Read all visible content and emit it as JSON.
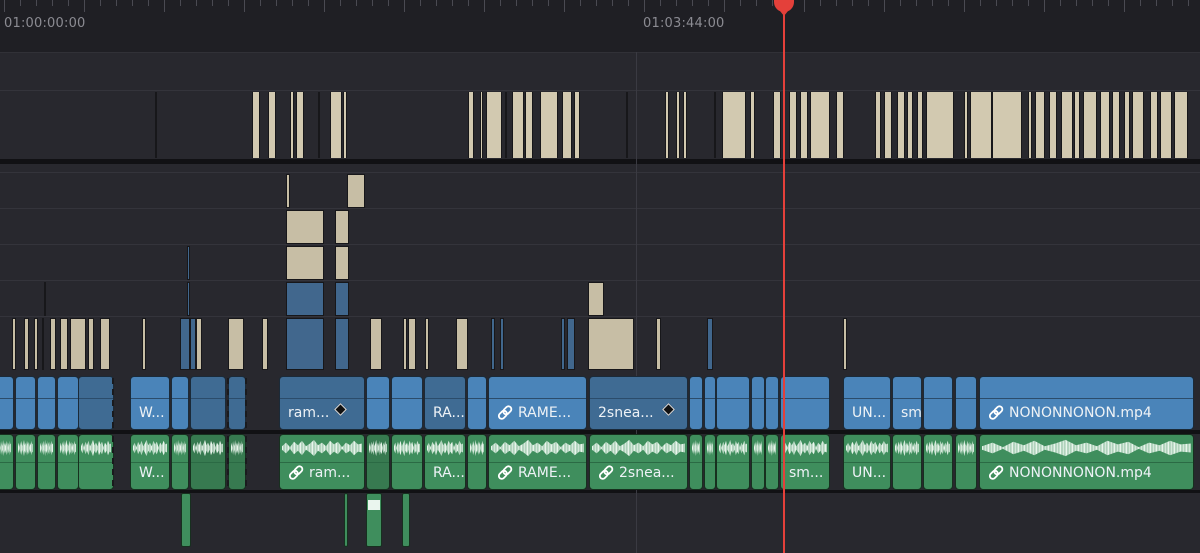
{
  "ruler": {
    "start_timecode": "01:00:00:00",
    "mark_timecode": "01:03:44:00"
  },
  "colors": {
    "video_clip": "#4a84b9",
    "audio_clip": "#3f8e5d",
    "title_clip": "#c7bea5",
    "playhead": "#e4403a",
    "background": "#28282e"
  },
  "video_clips": [
    {
      "label": ""
    },
    {
      "label": ""
    },
    {
      "label": ""
    },
    {
      "label": ""
    },
    {
      "label": ""
    },
    {
      "label": "W..."
    },
    {
      "label": ""
    },
    {
      "label": ""
    },
    {
      "label": ""
    },
    {
      "label": "ram..."
    },
    {
      "label": ""
    },
    {
      "label": ""
    },
    {
      "label": "RA..."
    },
    {
      "label": ""
    },
    {
      "label": "RAME..."
    },
    {
      "label": "2snea..."
    },
    {
      "label": ""
    },
    {
      "label": ""
    },
    {
      "label": "sm..."
    },
    {
      "label": "UN..."
    },
    {
      "label": ""
    },
    {
      "label": ""
    },
    {
      "label": ""
    },
    {
      "label": "NONONNONON.mp4"
    }
  ],
  "audio_clips": [
    {
      "label": ""
    },
    {
      "label": ""
    },
    {
      "label": ""
    },
    {
      "label": ""
    },
    {
      "label": ""
    },
    {
      "label": "W..."
    },
    {
      "label": ""
    },
    {
      "label": ""
    },
    {
      "label": ""
    },
    {
      "label": "ram..."
    },
    {
      "label": ""
    },
    {
      "label": "RA..."
    },
    {
      "label": "RAME..."
    },
    {
      "label": "2snea..."
    },
    {
      "label": ""
    },
    {
      "label": ""
    },
    {
      "label": "sm..."
    },
    {
      "label": "UN..."
    },
    {
      "label": ""
    },
    {
      "label": ""
    },
    {
      "label": ""
    },
    {
      "label": "NONONNONON.mp4"
    }
  ],
  "icons": {
    "link": "link-icon",
    "keyframe": "keyframe-icon",
    "playhead": "playhead-icon"
  }
}
